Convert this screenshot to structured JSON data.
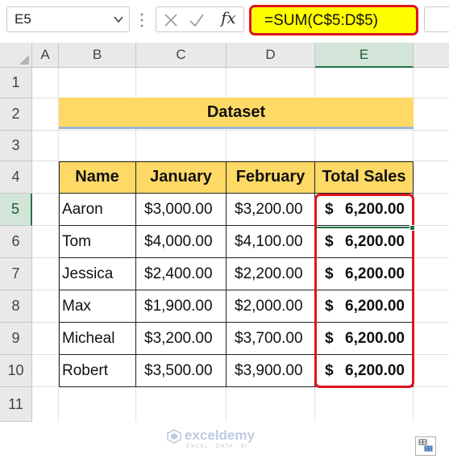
{
  "formula_bar": {
    "name_box": "E5",
    "fx_label": "fx",
    "formula": "=SUM(C$5:D$5)"
  },
  "columns": [
    "A",
    "B",
    "C",
    "D",
    "E"
  ],
  "selected_column": "E",
  "rows": [
    "1",
    "2",
    "3",
    "4",
    "5",
    "6",
    "7",
    "8",
    "9",
    "10",
    "11"
  ],
  "selected_row": "5",
  "dataset_title": "Dataset",
  "table": {
    "headers": [
      "Name",
      "January",
      "February",
      "Total Sales"
    ],
    "rows": [
      {
        "name": "Aaron",
        "january": "$3,000.00",
        "february": "$3,200.00",
        "total_symbol": "$",
        "total": "6,200.00"
      },
      {
        "name": "Tom",
        "january": "$4,000.00",
        "february": "$4,100.00",
        "total_symbol": "$",
        "total": "6,200.00"
      },
      {
        "name": "Jessica",
        "january": "$2,400.00",
        "february": "$2,200.00",
        "total_symbol": "$",
        "total": "6,200.00"
      },
      {
        "name": "Max",
        "january": "$1,900.00",
        "february": "$2,000.00",
        "total_symbol": "$",
        "total": "6,200.00"
      },
      {
        "name": "Micheal",
        "january": "$3,200.00",
        "february": "$3,700.00",
        "total_symbol": "$",
        "total": "6,200.00"
      },
      {
        "name": "Robert",
        "january": "$3,500.00",
        "february": "$3,900.00",
        "total_symbol": "$",
        "total": "6,200.00"
      }
    ]
  },
  "watermark": {
    "name": "exceldemy",
    "tagline": "EXCEL · DATA · BI"
  },
  "icons": {
    "dropdown": "chevron-down-icon",
    "cancel": "close-icon",
    "enter": "checkmark-icon",
    "quick_analysis": "quick-analysis-icon"
  },
  "colors": {
    "header_fill": "#ffd966",
    "highlight_border": "#e0141c",
    "formula_highlight": "#ffff00",
    "selection_green": "#217346"
  }
}
